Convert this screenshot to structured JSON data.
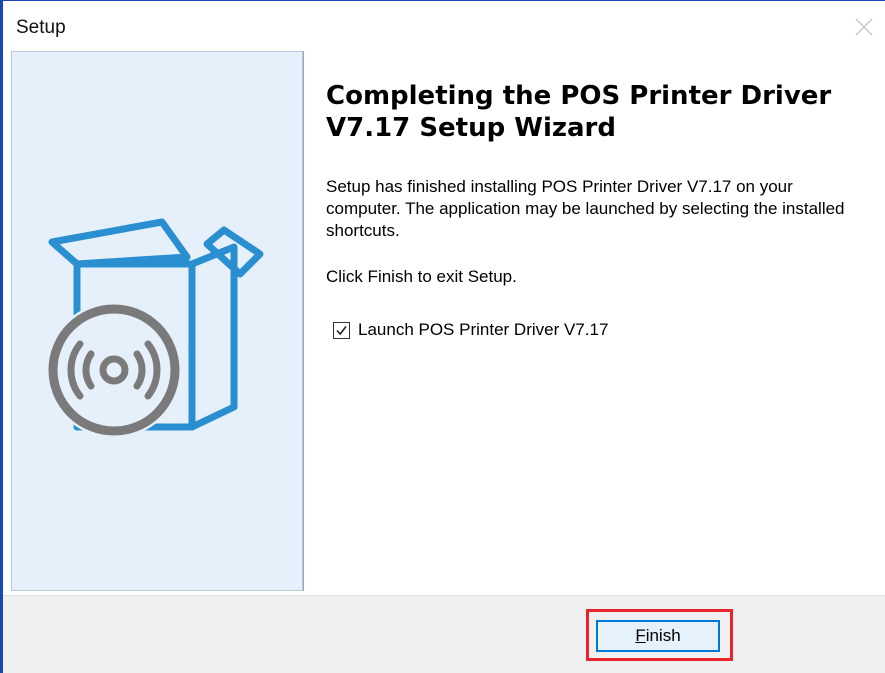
{
  "window": {
    "title": "Setup",
    "close_icon": "close-icon",
    "accent_color": "#1a47b8"
  },
  "wizard": {
    "heading": "Completing the POS Printer Driver V7.17 Setup Wizard",
    "body_text": "Setup has finished installing POS Printer Driver V7.17 on your computer. The application may be launched by selecting the installed shortcuts.",
    "exit_text": "Click Finish to exit Setup.",
    "launch_checkbox": {
      "label": "Launch POS Printer Driver V7.17",
      "checked": true
    },
    "side_image_icon": "open-box-with-disc-icon",
    "side_panel_color": "#e6f0fa",
    "artwork_blue": "#2a8fd1",
    "artwork_gray": "#7a7a7a"
  },
  "footer": {
    "finish_button": {
      "mnemonic": "F",
      "rest": "inish",
      "highlight_color": "#e8232b"
    }
  }
}
